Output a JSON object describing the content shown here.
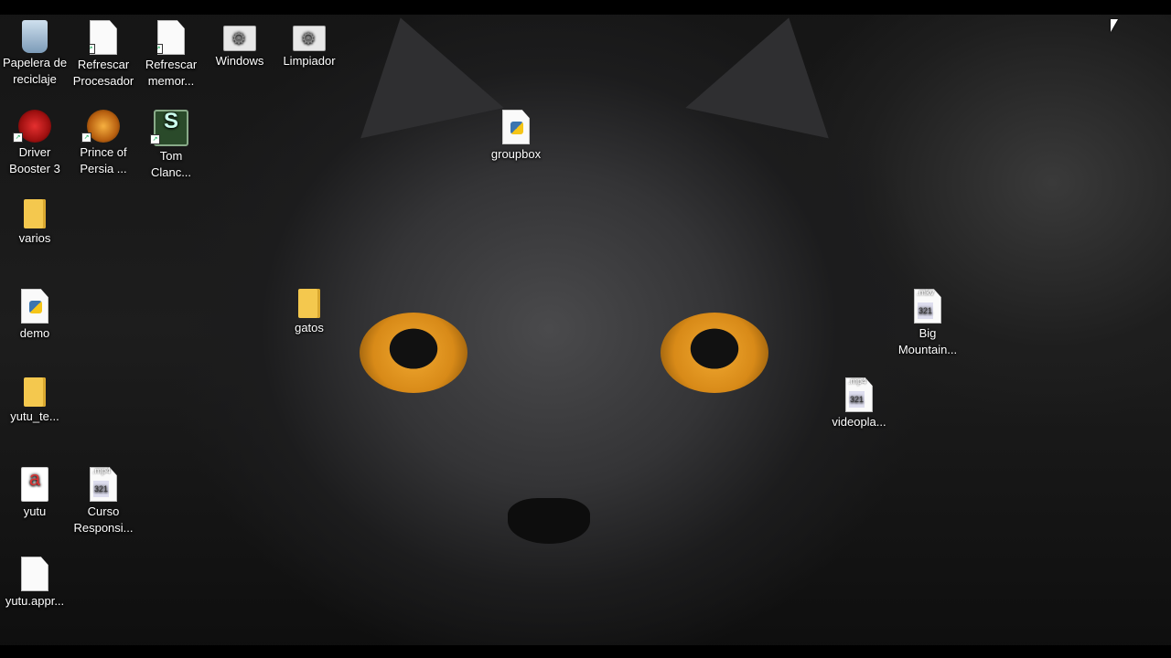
{
  "desktop": {
    "icons": [
      {
        "label": "Papelera de\nreciclaje"
      },
      {
        "label": "Refrescar\nProcesador"
      },
      {
        "label": "Refrescar\nmemor..."
      },
      {
        "label": "Windows"
      },
      {
        "label": "Limpiador"
      },
      {
        "label": "Driver\nBooster 3"
      },
      {
        "label": "Prince of\nPersia ..."
      },
      {
        "label": "Tom\nClanc..."
      },
      {
        "label": "groupbox"
      },
      {
        "label": "varios"
      },
      {
        "label": "demo"
      },
      {
        "label": "gatos"
      },
      {
        "label": "Big\nMountain...",
        "ext": ".mkv"
      },
      {
        "label": "videopla...",
        "ext": ".mp4"
      },
      {
        "label": "yutu_te..."
      },
      {
        "label": "yutu"
      },
      {
        "label": "Curso\nResponsi...",
        "ext": ".mp4"
      },
      {
        "label": "yutu.appr..."
      }
    ]
  }
}
